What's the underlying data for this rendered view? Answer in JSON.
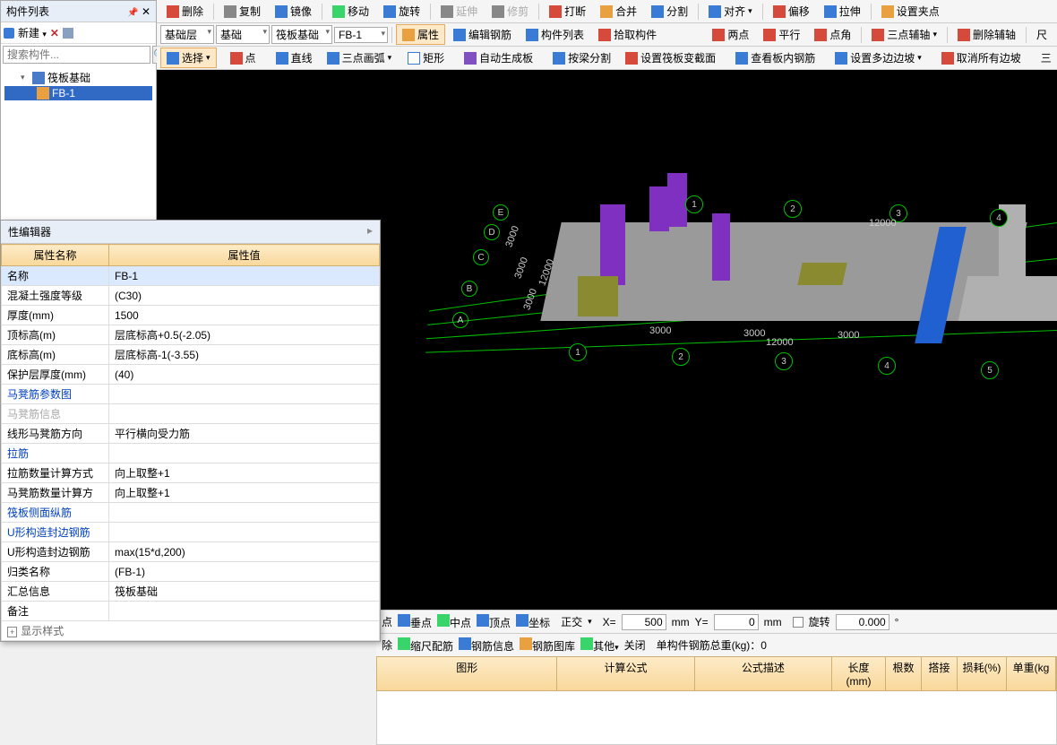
{
  "left_panel": {
    "title": "构件列表",
    "new_btn": "新建",
    "search_placeholder": "搜索构件...",
    "tree": {
      "root": "筏板基础",
      "child": "FB-1"
    }
  },
  "toolbar_edit": {
    "delete": "删除",
    "copy": "复制",
    "mirror": "镜像",
    "move": "移动",
    "rotate": "旋转",
    "extend": "延伸",
    "trim": "修剪",
    "break": "打断",
    "merge": "合并",
    "split": "分割",
    "align": "对齐",
    "offset": "偏移",
    "stretch": "拉伸",
    "setgrip": "设置夹点"
  },
  "toolbar_layer": {
    "floor": "基础层",
    "type": "基础",
    "subtype": "筏板基础",
    "member": "FB-1",
    "prop": "属性",
    "editrebar": "编辑钢筋",
    "memberlist": "构件列表",
    "pick": "拾取构件"
  },
  "toolbar_aux": {
    "twopoint": "两点",
    "parallel": "平行",
    "pointangle": "点角",
    "threepoint": "三点辅轴",
    "delaux": "删除辅轴",
    "ruler": "尺"
  },
  "toolbar_draw": {
    "select": "选择",
    "point": "点",
    "line": "直线",
    "arc": "三点画弧",
    "rect": "矩形",
    "autogen": "自动生成板",
    "beamsplit": "按梁分割",
    "setraft": "设置筏板变截面",
    "viewrebar": "查看板内钢筋",
    "multislope": "设置多边边坡",
    "cancelslope": "取消所有边坡",
    "tri": "三"
  },
  "prop_editor": {
    "title": "性编辑器",
    "header_name": "属性名称",
    "header_value": "属性值",
    "rows": [
      {
        "n": "名称",
        "v": "FB-1",
        "link": false,
        "sel": true
      },
      {
        "n": "混凝土强度等级",
        "v": "(C30)",
        "link": false
      },
      {
        "n": "厚度(mm)",
        "v": "1500",
        "link": false
      },
      {
        "n": "顶标高(m)",
        "v": "层底标高+0.5(-2.05)",
        "link": false
      },
      {
        "n": "底标高(m)",
        "v": "层底标高-1(-3.55)",
        "link": false
      },
      {
        "n": "保护层厚度(mm)",
        "v": "(40)",
        "link": false
      },
      {
        "n": "马凳筋参数图",
        "v": "",
        "link": true
      },
      {
        "n": "马凳筋信息",
        "v": "",
        "link": false,
        "gray": true
      },
      {
        "n": "线形马凳筋方向",
        "v": "平行横向受力筋",
        "link": false
      },
      {
        "n": "拉筋",
        "v": "",
        "link": true
      },
      {
        "n": "拉筋数量计算方式",
        "v": "向上取整+1",
        "link": false
      },
      {
        "n": "马凳筋数量计算方",
        "v": "向上取整+1",
        "link": false
      },
      {
        "n": "筏板侧面纵筋",
        "v": "",
        "link": true
      },
      {
        "n": "U形构造封边钢筋",
        "v": "",
        "link": true
      },
      {
        "n": "U形构造封边钢筋",
        "v": "max(15*d,200)",
        "link": false
      },
      {
        "n": "归类名称",
        "v": "(FB-1)",
        "link": false
      },
      {
        "n": "汇总信息",
        "v": "筏板基础",
        "link": false
      },
      {
        "n": "备注",
        "v": "",
        "link": false
      }
    ],
    "display_style": "显示样式"
  },
  "status_bar": {
    "endpoint": "点",
    "perp": "垂点",
    "mid": "中点",
    "apex": "顶点",
    "coord": "坐标",
    "ortho": "正交",
    "x_lbl": "X=",
    "x_val": "500",
    "x_unit": "mm",
    "y_lbl": "Y=",
    "y_val": "0",
    "y_unit": "mm",
    "rotate_lbl": "旋转",
    "rotate_val": "0.000"
  },
  "rebar_bar": {
    "del": "除",
    "scale": "缩尺配筋",
    "info": "钢筋信息",
    "lib": "钢筋图库",
    "other": "其他",
    "close": "关闭",
    "weight_label": "单构件钢筋总重(kg)：0"
  },
  "grid": {
    "cols": [
      "图形",
      "计算公式",
      "公式描述",
      "长度(mm)",
      "根数",
      "搭接",
      "损耗(%)",
      "单重(kg"
    ]
  },
  "scene": {
    "dims": [
      "3000",
      "3000",
      "3000",
      "12000",
      "3000",
      "3000",
      "12000",
      "3000",
      "3000",
      "3000",
      "12000"
    ],
    "axis_h": [
      "A",
      "B",
      "C",
      "D",
      "E"
    ],
    "axis_v": [
      "1",
      "2",
      "3",
      "4",
      "5"
    ]
  }
}
